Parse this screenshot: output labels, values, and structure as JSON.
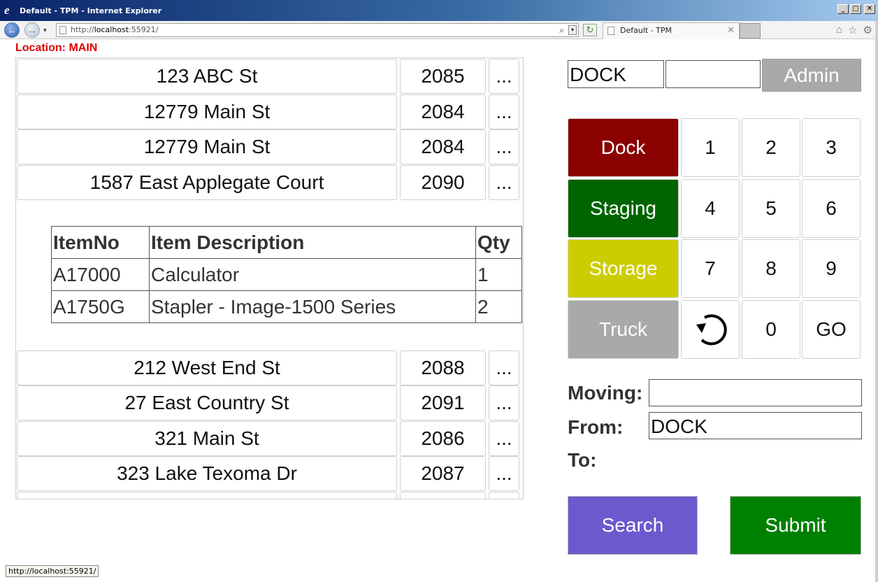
{
  "window": {
    "title": "Default - TPM - Internet Explorer",
    "minimize": "_",
    "maximize": "□",
    "close": "✕"
  },
  "browser": {
    "back_icon": "←",
    "forward_icon": "→",
    "dropdown_icon": "▾",
    "address_prefix": "http://",
    "address_host": "localhost",
    "address_suffix": ":55921/",
    "search_icon": "⌕",
    "address_dropdown_icon": "▾",
    "refresh_icon": "↻",
    "tab_title": "Default - TPM",
    "tab_close": "✕",
    "home_icon": "⌂",
    "favorites_icon": "☆",
    "tools_icon": "⚙"
  },
  "location": {
    "label": "Location: MAIN"
  },
  "orders_top": [
    {
      "address": "123 ABC St",
      "number": "2085",
      "more": "..."
    },
    {
      "address": "12779 Main St",
      "number": "2084",
      "more": "..."
    },
    {
      "address": "12779 Main St",
      "number": "2084",
      "more": "..."
    },
    {
      "address": "1587 East Applegate Court",
      "number": "2090",
      "more": "..."
    }
  ],
  "items_table": {
    "headers": [
      "ItemNo",
      "Item Description",
      "Qty"
    ],
    "rows": [
      [
        "A17000",
        "Calculator",
        "1"
      ],
      [
        "A1750G",
        "Stapler - Image-1500 Series",
        "2"
      ]
    ]
  },
  "orders_bottom": [
    {
      "address": "212 West End St",
      "number": "2088",
      "more": "..."
    },
    {
      "address": "27 East Country St",
      "number": "2091",
      "more": "..."
    },
    {
      "address": "321 Main St",
      "number": "2086",
      "more": "..."
    },
    {
      "address": "323 Lake Texoma Dr",
      "number": "2087",
      "more": "..."
    }
  ],
  "right_panel": {
    "location_input_value": "DOCK",
    "second_input_value": "",
    "admin_label": "Admin",
    "location_buttons": [
      {
        "label": "Dock",
        "color": "#8b0000"
      },
      {
        "label": "Staging",
        "color": "#006400"
      },
      {
        "label": "Storage",
        "color": "#cccc00"
      },
      {
        "label": "Truck",
        "color": "#a9a9a9"
      }
    ],
    "keypad": [
      "1",
      "2",
      "3",
      "4",
      "5",
      "6",
      "7",
      "8",
      "9",
      "0",
      "GO"
    ],
    "undo_icon": "↺",
    "moving_label": "Moving:",
    "moving_value": "",
    "from_label": "From:",
    "from_value": "DOCK",
    "to_label": "To:",
    "search_label": "Search",
    "search_color": "#6a5acd",
    "submit_label": "Submit",
    "submit_color": "#008000"
  },
  "statusbar": {
    "url": "http://localhost:55921/"
  }
}
